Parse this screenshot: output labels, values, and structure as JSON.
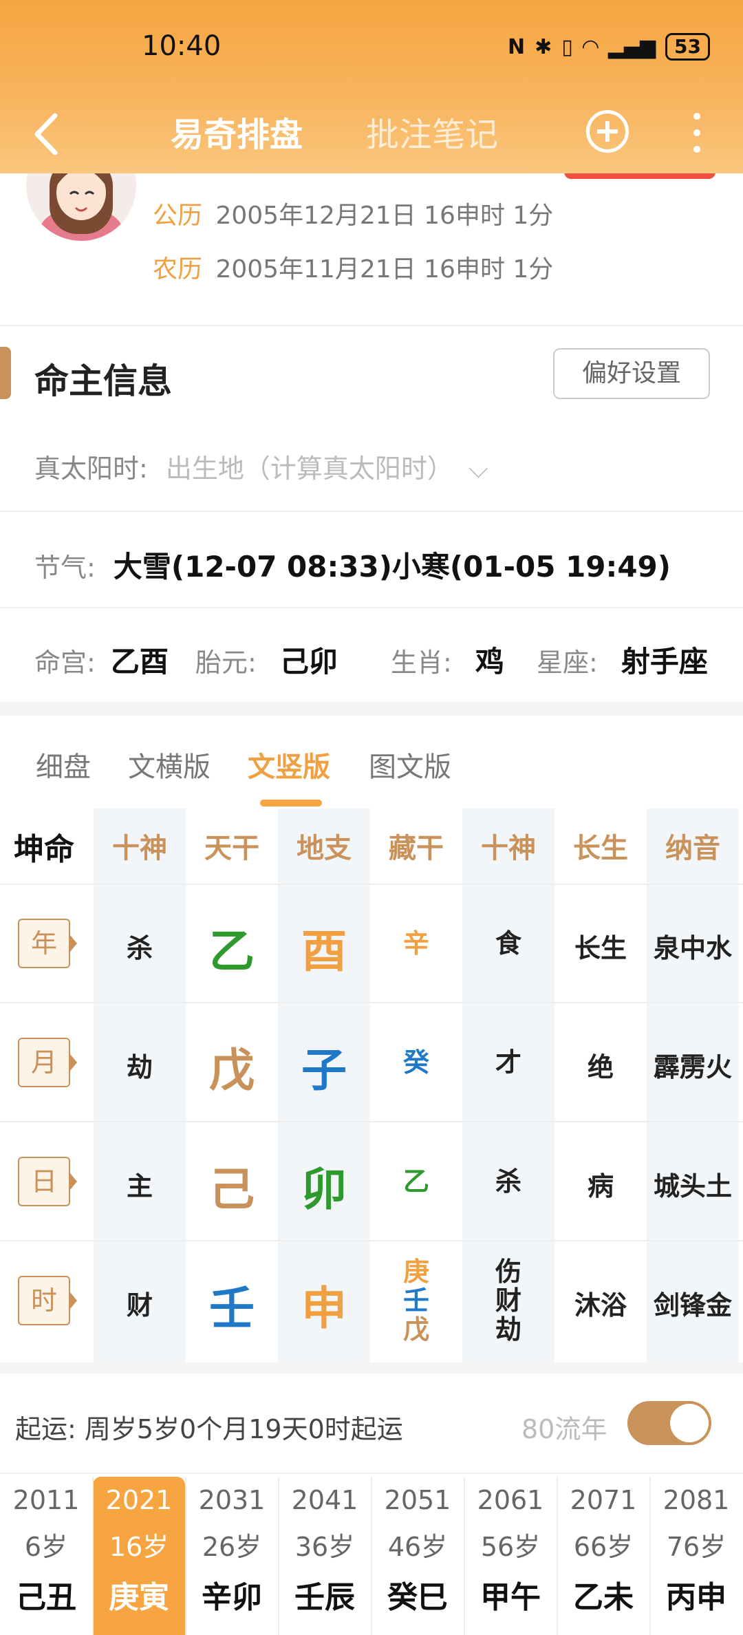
{
  "status": {
    "time": "10:40",
    "battery": "53"
  },
  "nav": {
    "tab_active": "易奇排盘",
    "tab_other": "批注笔记"
  },
  "profile": {
    "solar_label": "公历",
    "solar_value": "2005年12月21日 16申时 1分",
    "lunar_label": "农历",
    "lunar_value": "2005年11月21日 16申时 1分"
  },
  "info": {
    "title": "命主信息",
    "pref_button": "偏好设置",
    "true_solar_label": "真太阳时:",
    "true_solar_placeholder": "出生地（计算真太阳时）",
    "jieqi_label": "节气:",
    "jieqi_value": "大雪(12-07 08:33)小寒(01-05 19:49)",
    "minggong_label": "命宫:",
    "minggong_value": "乙酉",
    "taiyuan_label": "胎元:",
    "taiyuan_value": "己卯",
    "shengxiao_label": "生肖:",
    "shengxiao_value": "鸡",
    "xingzuo_label": "星座:",
    "xingzuo_value": "射手座"
  },
  "tabs": [
    "细盘",
    "文横版",
    "文竖版",
    "图文版"
  ],
  "active_tab": "文竖版",
  "grid": {
    "corner": "坤命",
    "headers": [
      "十神",
      "天干",
      "地支",
      "藏干",
      "十神",
      "长生",
      "纳音"
    ],
    "rows": [
      {
        "label": "年",
        "shishen": "杀",
        "tiangan": "乙",
        "dizhi": "酉",
        "canggan": [
          "辛"
        ],
        "shishen2": [
          "食"
        ],
        "changsheng": "长生",
        "nayin": "泉中水"
      },
      {
        "label": "月",
        "shishen": "劫",
        "tiangan": "戊",
        "dizhi": "子",
        "canggan": [
          "癸"
        ],
        "shishen2": [
          "才"
        ],
        "changsheng": "绝",
        "nayin": "霹雳火"
      },
      {
        "label": "日",
        "shishen": "主",
        "tiangan": "己",
        "dizhi": "卯",
        "canggan": [
          "乙"
        ],
        "shishen2": [
          "杀"
        ],
        "changsheng": "病",
        "nayin": "城头土"
      },
      {
        "label": "时",
        "shishen": "财",
        "tiangan": "壬",
        "dizhi": "申",
        "canggan": [
          "庚",
          "壬",
          "戊"
        ],
        "shishen2": [
          "伤",
          "财",
          "劫"
        ],
        "changsheng": "沐浴",
        "nayin": "剑锋金"
      }
    ],
    "colors": {
      "wood": "#2e9a2e",
      "fire": "#e03a2e",
      "earth": "#c9925a",
      "metal": "#f0a040",
      "water": "#1f78c8"
    }
  },
  "qiyun": {
    "text": "起运:  周岁5岁0个月19天0时起运",
    "flow_label": "80流年"
  },
  "dayun": [
    {
      "year": "2011",
      "age": "6岁",
      "gz": "己丑"
    },
    {
      "year": "2021",
      "age": "16岁",
      "gz": "庚寅"
    },
    {
      "year": "2031",
      "age": "26岁",
      "gz": "辛卯"
    },
    {
      "year": "2041",
      "age": "36岁",
      "gz": "壬辰"
    },
    {
      "year": "2051",
      "age": "46岁",
      "gz": "癸巳"
    },
    {
      "year": "2061",
      "age": "56岁",
      "gz": "甲午"
    },
    {
      "year": "2071",
      "age": "66岁",
      "gz": "乙未"
    },
    {
      "year": "2081",
      "age": "76岁",
      "gz": "丙申"
    }
  ],
  "dayun_active_index": 1
}
